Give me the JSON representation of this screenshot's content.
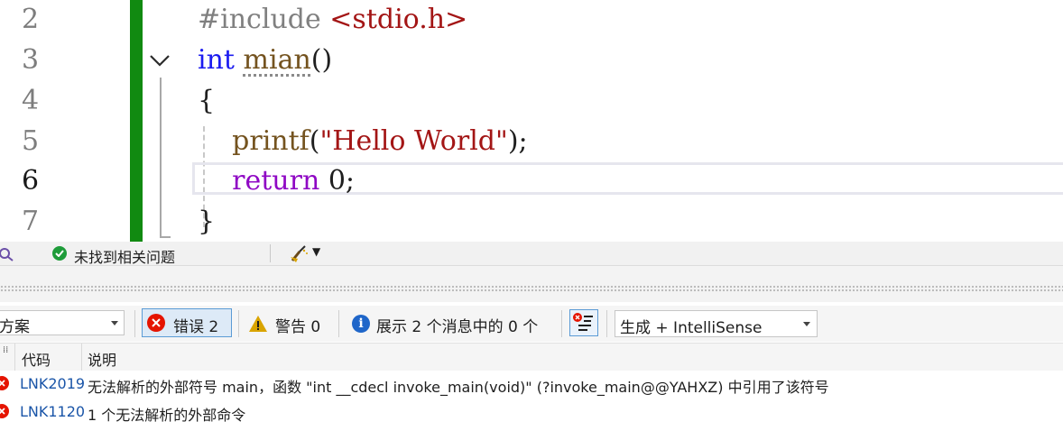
{
  "editor": {
    "line_numbers": [
      "2",
      "3",
      "4",
      "5",
      "6",
      "7"
    ],
    "current_line": "6",
    "lines": {
      "l2_directive": "#include",
      "l2_header": "<stdio.h>",
      "l3_type": "int",
      "l3_func": "mian",
      "l3_parens": "()",
      "l4_brace": "{",
      "l5_func": "printf",
      "l5_open": "(",
      "l5_string": "\"Hello World\"",
      "l5_close": ");",
      "l6_keyword": "return",
      "l6_rest": "0;",
      "l7_brace": "}"
    }
  },
  "editor_status": {
    "issues_text": "未找到相关问题"
  },
  "toolbar": {
    "scope_value": "方案",
    "errors_label": "错误 2",
    "warnings_label": "警告 0",
    "messages_label": "展示 2 个消息中的 0 个",
    "build_filter_value": "生成 + IntelliSense"
  },
  "grid": {
    "columns": {
      "code": "代码",
      "description": "说明"
    },
    "rows": [
      {
        "code": "LNK2019",
        "description": "无法解析的外部符号 main，函数 \"int __cdecl invoke_main(void)\" (?invoke_main@@YAHXZ) 中引用了该符号"
      },
      {
        "code": "LNK1120",
        "description": "1 个无法解析的外部命令"
      }
    ]
  },
  "colors": {
    "keyword": "#1c1cf0",
    "function": "#74531f",
    "string": "#a31515",
    "control_keyword": "#8f08c4",
    "change_bar": "#118a11",
    "error_red": "#e51400",
    "warning_yellow": "#d9a400",
    "info_blue": "#1f66c9"
  }
}
